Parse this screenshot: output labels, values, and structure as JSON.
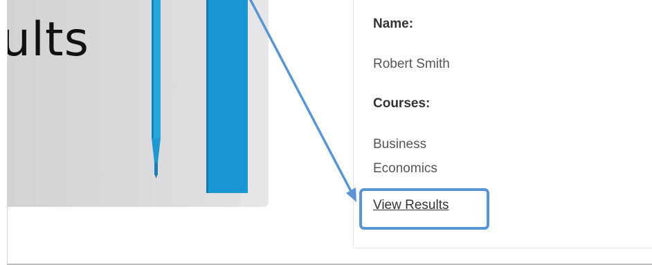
{
  "hero": {
    "text": "ults",
    "colors": {
      "background": "#d8d8da",
      "book": "#1a97d3",
      "pen": "#27a5de"
    }
  },
  "profile": {
    "name_label": "Name:",
    "name_value": "Robert Smith",
    "courses_label": "Courses:",
    "courses": [
      "Business",
      "Economics"
    ],
    "view_results_label": "View Results"
  },
  "annotation": {
    "color": "#5a94d3"
  }
}
